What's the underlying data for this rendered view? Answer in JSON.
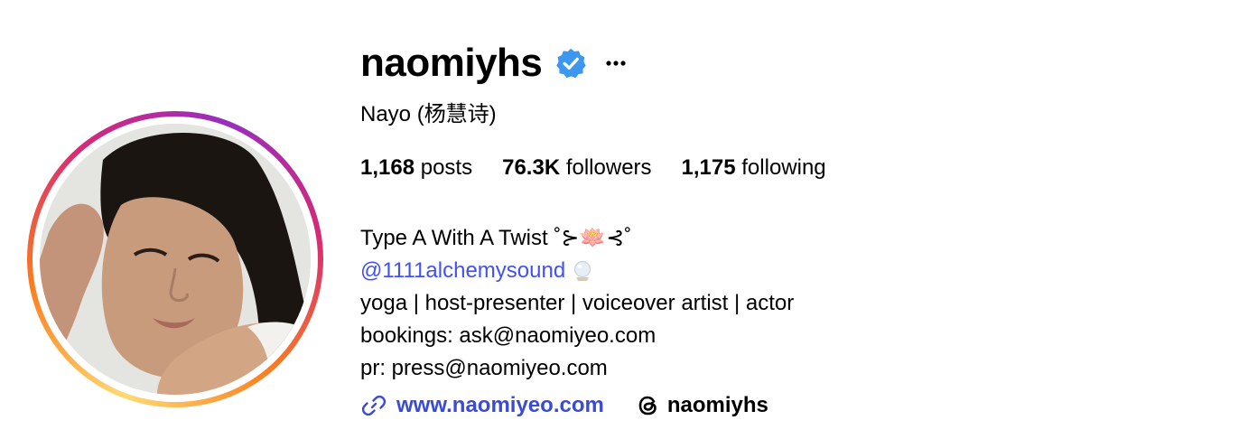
{
  "profile": {
    "username": "naomiyhs",
    "full_name": "Nayo (杨慧诗)",
    "verified_icon": "verified-badge-icon",
    "more_icon": "more-options-icon",
    "avatar_ring_colors": [
      "#feda75",
      "#fa7e1e",
      "#d62976",
      "#962fbf"
    ]
  },
  "stats": {
    "posts_count": "1,168",
    "posts_label": "posts",
    "followers_count": "76.3K",
    "followers_label": "followers",
    "following_count": "1,175",
    "following_label": "following"
  },
  "bio": {
    "line1": "Type A With A Twist ˚⊱🪷⊰˚",
    "mention": "@1111alchemysound",
    "line3": "yoga | host-presenter | voiceover artist | actor",
    "line4": "bookings: ask@naomiyeo.com",
    "line5": "pr: press@naomiyeo.com"
  },
  "links": {
    "website": "www.naomiyeo.com",
    "website_icon": "link-icon",
    "threads_handle": "naomiyhs",
    "threads_icon": "threads-icon"
  },
  "colors": {
    "link_blue": "#3a4bd6",
    "mention_blue": "#4150f7",
    "verified_blue": "#3b97f0"
  }
}
